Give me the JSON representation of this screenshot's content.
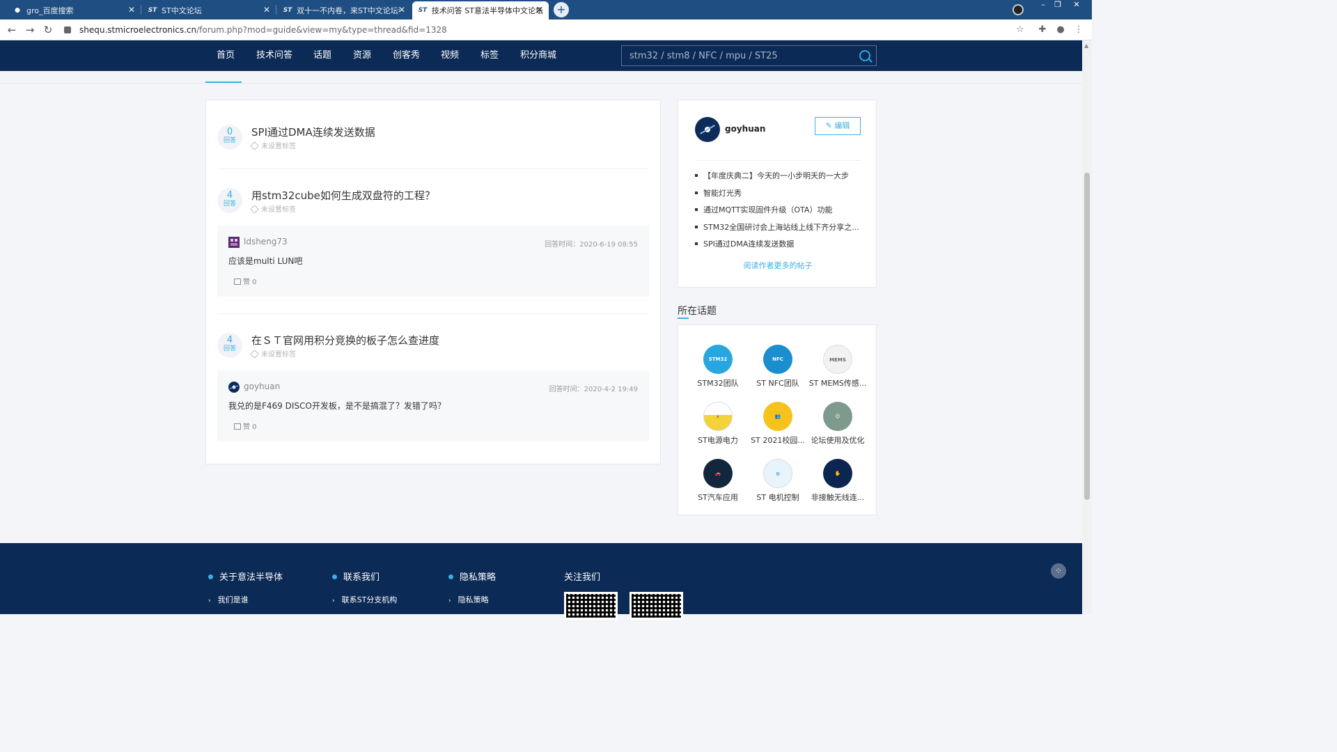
{
  "browser": {
    "tabs": [
      {
        "title": "gro_百度搜索",
        "icon": "baidu-paw-icon"
      },
      {
        "title": "ST中文论坛",
        "icon": "st-logo-icon"
      },
      {
        "title": "双十一不内卷，来ST中文论坛秒...",
        "icon": "st-logo-icon"
      },
      {
        "title": "技术问答 ST意法半导体中文论坛",
        "icon": "st-logo-icon"
      }
    ],
    "url_host": "shequ.stmicroelectronics.cn",
    "url_path": "/forum.php?mod=guide&view=my&type=thread&fid=1328"
  },
  "nav": {
    "items": [
      "首页",
      "技术问答",
      "话题",
      "资源",
      "创客秀",
      "视频",
      "标签",
      "积分商城"
    ],
    "search_placeholder": "stm32 / stm8 / NFC / mpu / ST25"
  },
  "questions": [
    {
      "count": "0",
      "count_label": "回答",
      "title": "SPI通过DMA连续发送数据",
      "tag": "未设置标签"
    },
    {
      "count": "4",
      "count_label": "回答",
      "title": "用stm32cube如何生成双盘符的工程？",
      "tag": "未设置标签",
      "answer": {
        "user": "ldsheng73",
        "time": "回答时间：2020-6-19 08:55",
        "text": "应该是multi LUN吧",
        "likes": "赞 0"
      }
    },
    {
      "count": "4",
      "count_label": "回答",
      "title": "在ＳＴ官网用积分竞换的板子怎么查进度",
      "tag": "未设置标签",
      "answer": {
        "user": "goyhuan",
        "time": "回答时间：2020-4-2 19:49",
        "text": "我兑的是F469 DISCO开发板，是不是搞混了？发错了吗？",
        "likes": "赞 0"
      }
    }
  ],
  "profile": {
    "name": "goyhuan",
    "edit_label": "编辑",
    "posts": [
      "【年度庆典二】今天的一小步明天的一大步",
      "智能灯光秀",
      "通过MQTT实现固件升级（OTA）功能",
      "STM32全国研讨会上海站线上线下齐分享之...",
      "SPI通过DMA连续发送数据"
    ],
    "more_link": "阅读作者更多的帖子"
  },
  "topics": {
    "heading": "所在话题",
    "items": [
      {
        "label": "STM32团队",
        "color": "#27a6df"
      },
      {
        "label": "ST NFC团队",
        "color": "#1a8ecf"
      },
      {
        "label": "ST MEMS传感...",
        "color": "#f2f2f2"
      },
      {
        "label": "ST电源电力",
        "color": "#f3d23a"
      },
      {
        "label": "ST 2021校园...",
        "color": "#f6c21b"
      },
      {
        "label": "论坛使用及优化",
        "color": "#7d9a8c"
      },
      {
        "label": "ST汽车应用",
        "color": "#12263d"
      },
      {
        "label": "ST 电机控制",
        "color": "#e8f4fb"
      },
      {
        "label": "非接触无线连...",
        "color": "#0d2551"
      }
    ]
  },
  "footer": {
    "sections": [
      {
        "heading": "关于意法半导体",
        "link": "我们是谁"
      },
      {
        "heading": "联系我们",
        "link": "联系ST分支机构"
      },
      {
        "heading": "隐私策略",
        "link": "隐私策略"
      }
    ],
    "follow": "关注我们"
  }
}
